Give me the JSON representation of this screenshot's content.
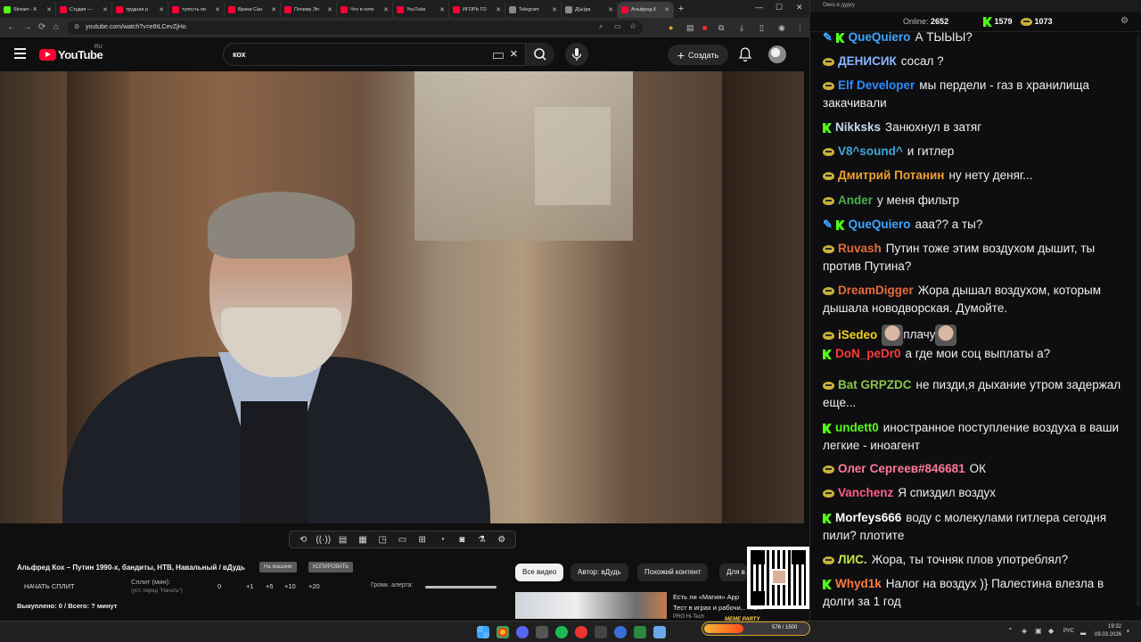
{
  "browser": {
    "tabs": [
      {
        "label": "Stream - K",
        "color": "#53fc18"
      },
      {
        "label": "Студия —",
        "color": "#ff0033"
      },
      {
        "label": "трудная р",
        "color": "#ff0033"
      },
      {
        "label": "тупость по",
        "color": "#ff0033"
      },
      {
        "label": "Врачи Сан",
        "color": "#ff0033"
      },
      {
        "label": "Почему Эп",
        "color": "#ff0033"
      },
      {
        "label": "Что в хоти",
        "color": "#ff0033"
      },
      {
        "label": "YouTube",
        "color": "#ff0033"
      },
      {
        "label": "ИГОРЬ ГО",
        "color": "#ff0033"
      },
      {
        "label": "Telegram",
        "color": "#8a8a8a"
      },
      {
        "label": "Д(ы)ра",
        "color": "#8a8a8a"
      },
      {
        "label": "Альфред К",
        "color": "#ff0033"
      }
    ],
    "url": "youtube.com/watch?v=e6tLCevZjHo"
  },
  "youtube": {
    "logo_text": "YouTube",
    "region": "RU",
    "search_value": "кох",
    "create_label": "Создать",
    "video_title": "Альфред Кох – Путин 1990-х, бандиты, НТВ, Навальный / вДудь",
    "chips_grey": [
      "На машине",
      "КОПИРОВАТЬ"
    ],
    "start_split_label": "НАЧАТЬ СПЛИТ",
    "split_label": "Сплит (мин):",
    "split_hint": "(уст. перед \"Начать\")",
    "split_value": "0",
    "split_buttons": [
      "+1",
      "+5",
      "+10",
      "+20"
    ],
    "alert_label": "Громк. алерта:",
    "paid_text": "Выкуплено: 0 / Всего: ? минут",
    "filter_chips": [
      "Все видео",
      "Автор: вДудь",
      "Похожий контент",
      "Для в"
    ],
    "recommendation": {
      "title_line1": "Есть ли «Магия» App",
      "title_line2": "Тест в играх и рабочи... ПО...",
      "channel": "PRO Hi-Tech"
    }
  },
  "toolbar_icons": [
    "loop-icon",
    "broadcast-icon",
    "stats-icon",
    "film-icon",
    "pip-icon",
    "subtitles-icon",
    "add-video-icon",
    "speed-icon",
    "screenshot-icon",
    "flask-icon",
    "settings-icon"
  ],
  "chat": {
    "title": "Окно в дудку",
    "online_label": "Online:",
    "online_count": "2652",
    "kick_count": "1579",
    "cat_count": "1073",
    "messages": [
      {
        "user": "QueQuiero",
        "color": "#3ea6ff",
        "badges": [
          "pencil",
          "kick"
        ],
        "text": "А ТЫЫЫ?"
      },
      {
        "user": "ДЕНИСИК",
        "color": "#8ab4ff",
        "badges": [
          "cat"
        ],
        "text": "сосал ?"
      },
      {
        "user": "Elf Developer",
        "color": "#2f8cff",
        "badges": [
          "cat"
        ],
        "text": "мы пердели - газ в хранилища закачивали"
      },
      {
        "user": "Nikksks",
        "color": "#c5d9f0",
        "badges": [
          "kick"
        ],
        "text": "Занюхнул в затяг"
      },
      {
        "user": "V8^sound^",
        "color": "#3fa9d6",
        "badges": [
          "cat"
        ],
        "text": "и гитлер"
      },
      {
        "user": "Дмитрий Потанин",
        "color": "#f0a030",
        "badges": [
          "cat"
        ],
        "text": "ну нету деняг..."
      },
      {
        "user": "Ander",
        "color": "#4caf50",
        "badges": [
          "cat"
        ],
        "text": "у меня фильтр"
      },
      {
        "user": "QueQuiero",
        "color": "#3ea6ff",
        "badges": [
          "pencil",
          "kick"
        ],
        "text": "ааа?? а ты?"
      },
      {
        "user": "Ruvash",
        "color": "#e46b3c",
        "badges": [
          "cat"
        ],
        "text": "Путин тоже этим воздухом дышит, ты против Путина?"
      },
      {
        "user": "DreamDigger",
        "color": "#e46b3c",
        "badges": [
          "cat"
        ],
        "text": "Жора дышал воздухом, которым дышала новодворская. Думойте."
      },
      {
        "user": "iSedeo",
        "color": "#f2d31b",
        "badges": [
          "cat"
        ],
        "text": "плачу"
      },
      {
        "user": "DoN_peDr0",
        "color": "#ff3b3b",
        "badges": [
          "kick"
        ],
        "text": "а где мои соц выплаты а?"
      },
      {
        "user": "Bat  GRPZDC",
        "color": "#8bc34a",
        "badges": [
          "cat"
        ],
        "text": "не пизди,я дыхание утром задержал еще..."
      },
      {
        "user": "undett0",
        "color": "#53fc18",
        "badges": [
          "kick"
        ],
        "text": "иностранное поступление воздуха в ваши легкие - иноагент"
      },
      {
        "user": "Олег Сергеев#846681",
        "color": "#ff7a9a",
        "badges": [
          "cat"
        ],
        "text": "ОК"
      },
      {
        "user": "Vanchenz",
        "color": "#ff5f8a",
        "badges": [
          "cat"
        ],
        "text": "Я спиздил воздух"
      },
      {
        "user": "Morfeys666",
        "color": "#ffffff",
        "badges": [
          "kick"
        ],
        "text": "воду с молекулами гитлера сегодня пили? плотите"
      },
      {
        "user": "ЛИС.",
        "color": "#c7e84a",
        "badges": [
          "cat"
        ],
        "text": "Жора, ты точняк плов употреблял?"
      },
      {
        "user": "Whyd1k",
        "color": "#ff7a3c",
        "badges": [
          "kick"
        ],
        "text": "Налог на воздух )} Палестина влезла в долги за 1 год"
      }
    ]
  },
  "taskbar": {
    "meme_label": "MEME PARTY",
    "meme_count": "576 / 1500",
    "meme_progress": 0.38,
    "lang": "РУС",
    "time": "19:32",
    "date": "09.03.2026"
  }
}
